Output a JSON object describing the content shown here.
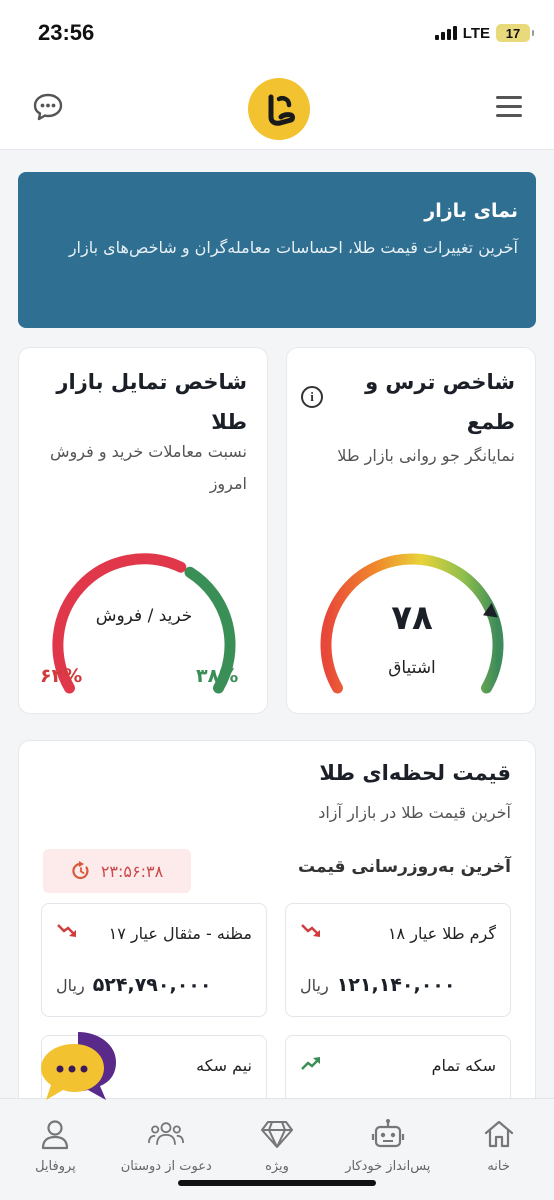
{
  "status_bar": {
    "time": "23:56",
    "network": "LTE",
    "battery": "17"
  },
  "header": {
    "chat_icon": "chat-bubble-icon",
    "logo_icon": "gold-logo-icon",
    "menu_icon": "hamburger-menu-icon"
  },
  "banner": {
    "title": "نمای بازار",
    "text": "آخرین تغییرات قیمت طلا، احساسات معامله‌گران و شاخص‌های بازار",
    "color": "#2f6f91"
  },
  "fear_greed": {
    "title": "شاخص ترس و طمع",
    "subtitle": "نمایانگر جو روانی بازار طلا",
    "value": "۷۸",
    "value_fraction": 0.78,
    "label": "اشتیاق",
    "info_icon": "info-icon"
  },
  "sentiment": {
    "title": "شاخص تمایل بازار طلا",
    "subtitle": "نسبت معاملات خرید و فروش امروز",
    "center_label": "خرید / فروش",
    "buy_percent": "۳۸%",
    "sell_percent": "۶۲%",
    "buy_fraction": 0.38,
    "sell_fraction": 0.62,
    "buy_color": "#3a8f57",
    "sell_color": "#e0384a"
  },
  "live_price": {
    "title": "قیمت لحظه‌ای طلا",
    "subtitle": "آخرین قیمت طلا در بازار آزاد",
    "update_label": "آخرین به‌روزرسانی قیمت",
    "timer": "۲۳:۵۶:۳۸",
    "items": [
      {
        "name": "گرم طلا عیار ۱۸",
        "price": "۱۲۱,۱۴۰,۰۰۰",
        "unit": "ریال",
        "trend": "down"
      },
      {
        "name": "مظنه - مثقال عیار ۱۷",
        "price": "۵۲۴,۷۹۰,۰۰۰",
        "unit": "ریال",
        "trend": "down"
      },
      {
        "name": "سکه تمام",
        "trend": "up"
      },
      {
        "name": "نیم سکه",
        "trend": "down"
      }
    ]
  },
  "bottom_nav": [
    {
      "label": "خانه",
      "icon": "home-icon"
    },
    {
      "label": "پس‌انداز خودکار",
      "icon": "robot-icon"
    },
    {
      "label": "ویژه",
      "icon": "diamond-icon"
    },
    {
      "label": "دعوت از دوستان",
      "icon": "users-icon"
    },
    {
      "label": "پروفایل",
      "icon": "profile-icon"
    }
  ],
  "colors": {
    "accent_gold": "#f2c230",
    "up": "#3a8f57",
    "down": "#d23b3b",
    "fab": "#5a2a8a"
  }
}
